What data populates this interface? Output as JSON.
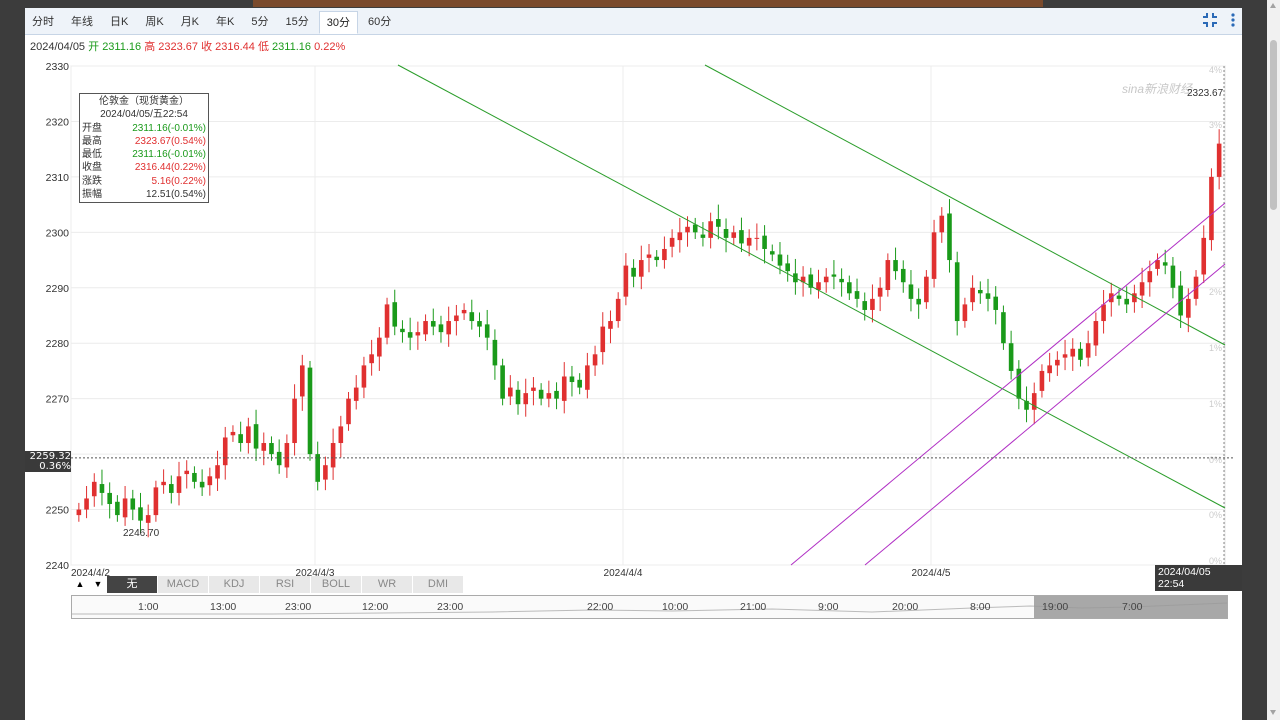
{
  "tabs": [
    "分时",
    "年线",
    "日K",
    "周K",
    "月K",
    "年K",
    "5分",
    "15分",
    "30分",
    "60分"
  ],
  "active_tab": "30分",
  "toolbar": {
    "expand_icon": "compress-icon",
    "more_icon": "more-vertical-icon"
  },
  "info": {
    "date": "2024/04/05",
    "open_label": "开",
    "open": "2311.16",
    "high_label": "高",
    "high": "2323.67",
    "close_label": "收",
    "close": "2316.44",
    "low_label": "低",
    "low": "2311.16",
    "change": "0.22%"
  },
  "tooltip": {
    "title": "伦敦金（现货黄金）",
    "time": "2024/04/05/五22:54",
    "rows": [
      {
        "label": "开盘",
        "value": "2311.16(-0.01%)",
        "color": "g"
      },
      {
        "label": "最高",
        "value": "2323.67(0.54%)",
        "color": "r"
      },
      {
        "label": "最低",
        "value": "2311.16(-0.01%)",
        "color": "g"
      },
      {
        "label": "收盘",
        "value": "2316.44(0.22%)",
        "color": "r"
      },
      {
        "label": "涨跌",
        "value": "5.16(0.22%)",
        "color": "r"
      },
      {
        "label": "振幅",
        "value": "12.51(0.54%)",
        "color": "k"
      }
    ]
  },
  "watermark": "sina新浪财经",
  "max_label": "2323.67",
  "min_label": "2246.70",
  "current_line": {
    "value": "2259.32",
    "pct": "0.36%"
  },
  "hover_date": "2024/04/05 22:54",
  "indicator_tabs": [
    "无",
    "MACD",
    "KDJ",
    "RSI",
    "BOLL",
    "WR",
    "DMI"
  ],
  "indicator_selected": "无",
  "navigator_labels": [
    "1:00",
    "13:00",
    "23:00",
    "12:00",
    "23:00",
    "22:00",
    "10:00",
    "21:00",
    "9:00",
    "20:00",
    "8:00",
    "19:00",
    "7:00"
  ],
  "chart_data": {
    "type": "candlestick",
    "ylim": [
      2240,
      2330
    ],
    "y_ticks": [
      2330,
      2320,
      2310,
      2300,
      2290,
      2280,
      2270,
      2260,
      2250,
      2240
    ],
    "pct_ticks": [
      "4%",
      "3%",
      "2%",
      "1%",
      "1%",
      "0%",
      "0%",
      "0%"
    ],
    "x_tick_labels": [
      "2024/4/2",
      "2024/4/3",
      "2024/4/4",
      "2024/4/5"
    ],
    "candles_close_series": [
      2250,
      2252,
      2255,
      2253,
      2251,
      2249,
      2252,
      2250,
      2248,
      2249,
      2254,
      2255,
      2253,
      2256,
      2257,
      2255,
      2254,
      2256,
      2258,
      2263,
      2264,
      2262,
      2265,
      2261,
      2262,
      2260,
      2258,
      2262,
      2270,
      2276,
      2260,
      2255,
      2258,
      2262,
      2265,
      2270,
      2272,
      2276,
      2278,
      2281,
      2287,
      2283,
      2282,
      2281,
      2282,
      2284,
      2283,
      2282,
      2284,
      2285,
      2286,
      2284,
      2283,
      2281,
      2276,
      2270,
      2272,
      2269,
      2271,
      2272,
      2270,
      2271,
      2270,
      2274,
      2273,
      2272,
      2276,
      2278,
      2283,
      2284,
      2288,
      2294,
      2292,
      2295,
      2296,
      2295,
      2297,
      2299,
      2300,
      2301,
      2300,
      2299,
      2302,
      2301,
      2299,
      2300,
      2298,
      2299,
      2299,
      2297,
      2296,
      2294,
      2293,
      2291,
      2292,
      2290,
      2291,
      2292,
      2292,
      2291,
      2289,
      2288,
      2286,
      2288,
      2290,
      2295,
      2293,
      2291,
      2288,
      2287,
      2292,
      2300,
      2303,
      2295,
      2284,
      2287,
      2290,
      2289,
      2288,
      2286,
      2280,
      2275,
      2270,
      2268,
      2271,
      2275,
      2276,
      2277,
      2278,
      2279,
      2277,
      2280,
      2284,
      2287,
      2289,
      2288,
      2287,
      2289,
      2291,
      2293,
      2295,
      2294,
      2290,
      2285,
      2288,
      2292,
      2299,
      2310,
      2316
    ]
  }
}
